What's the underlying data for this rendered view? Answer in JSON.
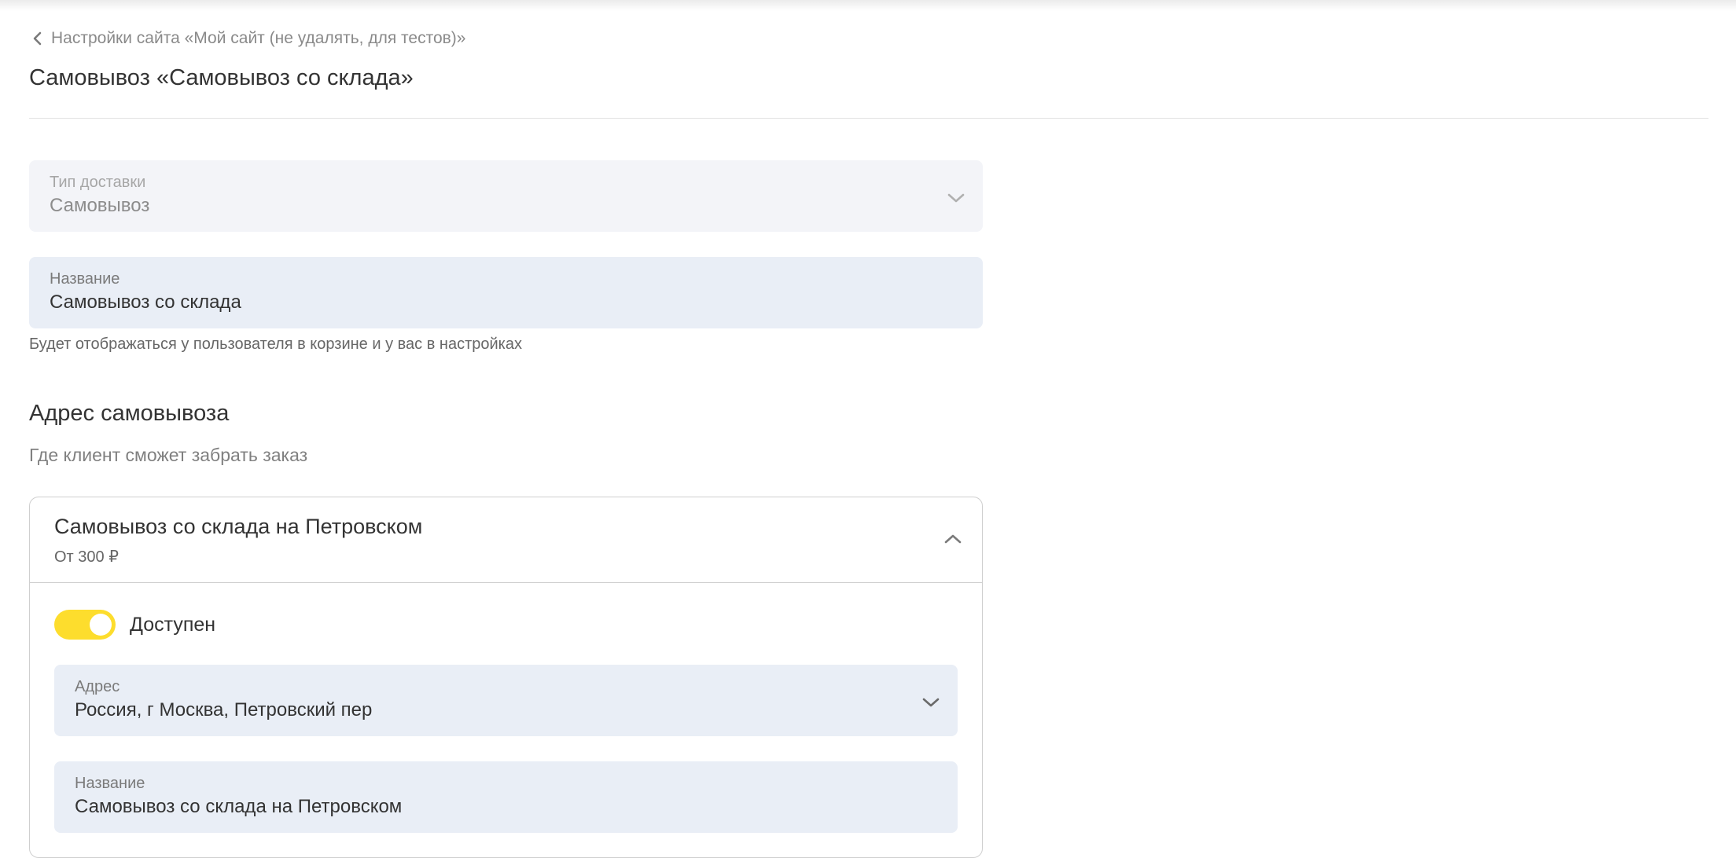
{
  "breadcrumb": {
    "label": "Настройки сайта «Мой сайт (не удалять, для тестов)»"
  },
  "page_title": "Самовывоз «Самовывоз со склада»",
  "delivery_type": {
    "label": "Тип доставки",
    "value": "Самовывоз"
  },
  "name_field": {
    "label": "Название",
    "value": "Самовывоз со склада",
    "hint": "Будет отображаться у пользователя в корзине и у вас в настройках"
  },
  "pickup_section": {
    "title": "Адрес самовывоза",
    "subtitle": "Где клиент сможет забрать заказ"
  },
  "pickup_card": {
    "title": "Самовывоз со склада на Петровском",
    "price": "От 300 ₽",
    "available_label": "Доступен",
    "available": true,
    "address": {
      "label": "Адрес",
      "value": "Россия, г Москва, Петровский пер"
    },
    "name": {
      "label": "Название",
      "value": "Самовывоз со склада на Петровском"
    }
  },
  "colors": {
    "toggle_on": "#fddd2d",
    "field_bg": "#e9eef6",
    "field_disabled_bg": "#f3f4f8"
  }
}
